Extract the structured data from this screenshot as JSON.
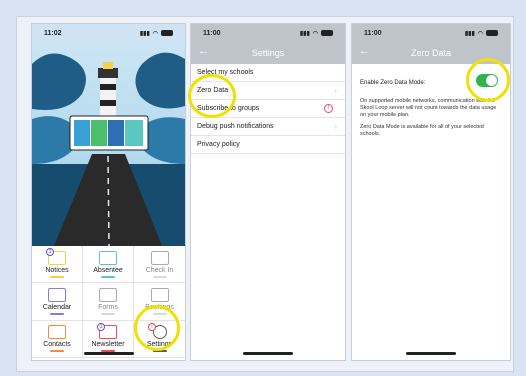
{
  "phone1": {
    "time": "11:02",
    "tiles": [
      {
        "label": "Notices",
        "icon": "notice-icon",
        "underline": "#f4d23a",
        "dim": false,
        "badge": "1"
      },
      {
        "label": "Absentee",
        "icon": "envelope-icon",
        "underline": "#5cc6c7",
        "dim": false
      },
      {
        "label": "Check In",
        "icon": "location-pin-icon",
        "underline": "#d9d9d9",
        "dim": true
      },
      {
        "label": "Calendar",
        "icon": "calendar-icon",
        "underline": "#8a7ad6",
        "dim": false
      },
      {
        "label": "Forms",
        "icon": "form-icon",
        "underline": "#d9d9d9",
        "dim": true
      },
      {
        "label": "Bookings",
        "icon": "bookings-icon",
        "underline": "#d9d9d9",
        "dim": true
      },
      {
        "label": "Contacts",
        "icon": "contacts-icon",
        "underline": "#f08a44",
        "dim": false
      },
      {
        "label": "Newsletter",
        "icon": "newsletter-icon",
        "underline": "#e64b5f",
        "dim": false,
        "badge": "1"
      },
      {
        "label": "Settings",
        "icon": "gear-icon",
        "underline": "#5a5a5a",
        "dim": false,
        "badge": "!"
      }
    ]
  },
  "phone2": {
    "time": "11:00",
    "title": "Settings",
    "items": [
      {
        "label": "Select my schools",
        "chevron": false
      },
      {
        "label": "Zero Data",
        "chevron": true
      },
      {
        "label": "Subscribe to groups",
        "chevron": false,
        "alert": "!"
      },
      {
        "label": "Debug push notifications",
        "chevron": true
      },
      {
        "label": "Privacy policy",
        "chevron": false
      }
    ]
  },
  "phone3": {
    "time": "11:00",
    "title": "Zero Data",
    "setting_label": "Enable Zero Data Mode:",
    "toggle_on": true,
    "desc1": "On supported mobile networks, communication with the Skool Loop server will not count towards the data usage on your mobile plan.",
    "desc2": "Zero Data Mode is available for all of your selected schools."
  },
  "colors": {
    "navbar": "#bfc4cb",
    "highlight": "#f2e100",
    "toggle": "#2fb34a"
  }
}
